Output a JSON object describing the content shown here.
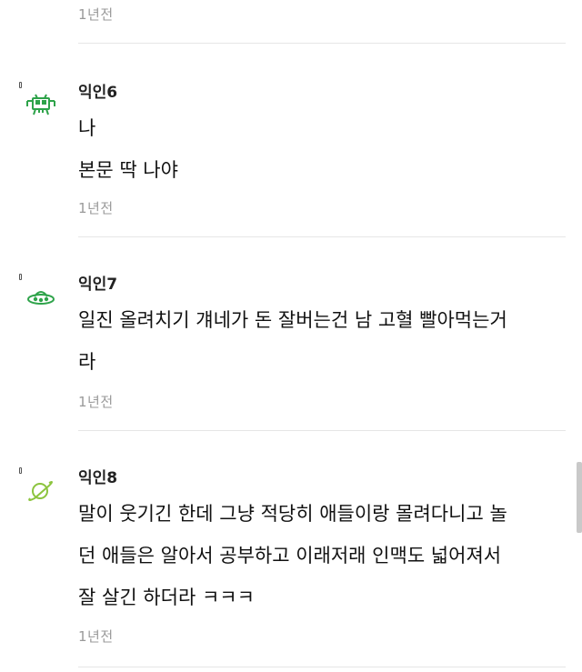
{
  "top": {
    "time": "1년전"
  },
  "comments": [
    {
      "nickname": "익인6",
      "avatar_icon": "pixel-invader-icon",
      "lines": [
        "나",
        "본문 딱 나야"
      ],
      "time": "1년전"
    },
    {
      "nickname": "익인7",
      "avatar_icon": "ufo-icon",
      "lines": [
        "일진 올려치기 걔네가 돈 잘버는건 남 고혈 빨아먹는거",
        "라"
      ],
      "time": "1년전"
    },
    {
      "nickname": "익인8",
      "avatar_icon": "planet-icon",
      "lines": [
        "말이 웃기긴 한데 그냥 적당히 애들이랑 몰려다니고 놀",
        "던 애들은 알아서 공부하고 이래저래 인맥도 넓어져서",
        "잘 살긴 하더라 ㅋㅋㅋ"
      ],
      "time": "1년전"
    }
  ],
  "colors": {
    "accent": "#2ea34a",
    "divider": "#e6e6e6",
    "time": "#9a9a9a"
  }
}
